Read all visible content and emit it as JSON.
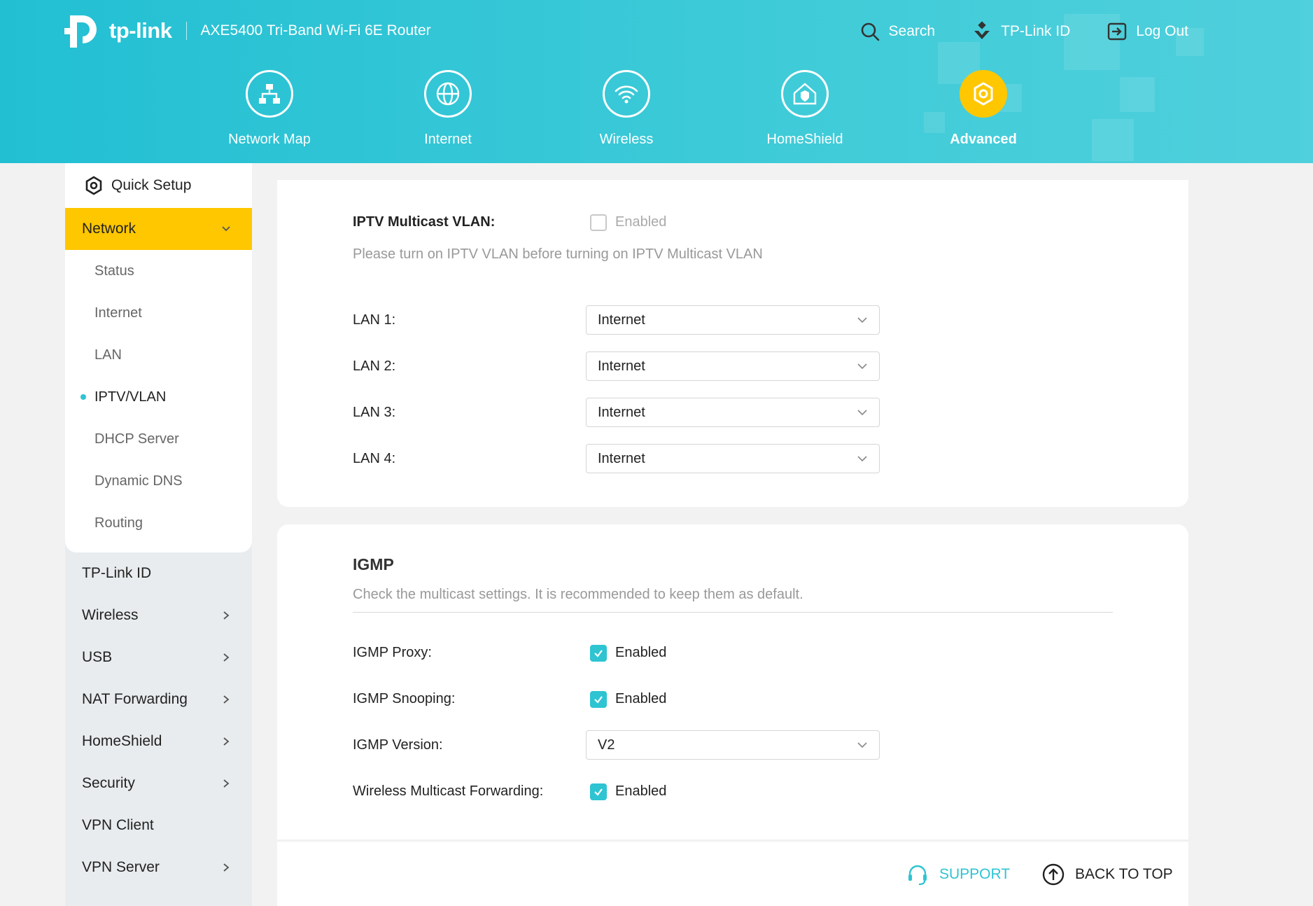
{
  "header": {
    "brand": "tp-link",
    "model": "AXE5400 Tri-Band Wi-Fi 6E Router",
    "actions": [
      {
        "label": "Search",
        "icon": "search-icon"
      },
      {
        "label": "TP-Link ID",
        "icon": "tplink-id-icon"
      },
      {
        "label": "Log Out",
        "icon": "logout-icon"
      }
    ],
    "nav": [
      {
        "label": "Network Map",
        "icon": "network-map-icon",
        "active": false
      },
      {
        "label": "Internet",
        "icon": "globe-icon",
        "active": false
      },
      {
        "label": "Wireless",
        "icon": "wifi-icon",
        "active": false
      },
      {
        "label": "HomeShield",
        "icon": "homeshield-icon",
        "active": false
      },
      {
        "label": "Advanced",
        "icon": "gear-icon",
        "active": true
      }
    ]
  },
  "sidebar": {
    "quick_setup": "Quick Setup",
    "network": {
      "label": "Network",
      "items": [
        {
          "label": "Status"
        },
        {
          "label": "Internet"
        },
        {
          "label": "LAN"
        },
        {
          "label": "IPTV/VLAN",
          "active": true
        },
        {
          "label": "DHCP Server"
        },
        {
          "label": "Dynamic DNS"
        },
        {
          "label": "Routing"
        }
      ]
    },
    "items": [
      {
        "label": "TP-Link ID",
        "expandable": false
      },
      {
        "label": "Wireless",
        "expandable": true
      },
      {
        "label": "USB",
        "expandable": true
      },
      {
        "label": "NAT Forwarding",
        "expandable": true
      },
      {
        "label": "HomeShield",
        "expandable": true
      },
      {
        "label": "Security",
        "expandable": true
      },
      {
        "label": "VPN Client",
        "expandable": false
      },
      {
        "label": "VPN Server",
        "expandable": true
      }
    ]
  },
  "iptv": {
    "multicast_vlan": {
      "label": "IPTV Multicast VLAN:",
      "checkbox_text": "Enabled",
      "checked": false
    },
    "note": "Please turn on IPTV VLAN before turning on IPTV Multicast VLAN",
    "lan_ports": [
      {
        "label": "LAN 1:",
        "value": "Internet"
      },
      {
        "label": "LAN 2:",
        "value": "Internet"
      },
      {
        "label": "LAN 3:",
        "value": "Internet"
      },
      {
        "label": "LAN 4:",
        "value": "Internet"
      }
    ]
  },
  "igmp": {
    "title": "IGMP",
    "description": "Check the multicast settings. It is recommended to keep them as default.",
    "proxy": {
      "label": "IGMP Proxy:",
      "text": "Enabled",
      "checked": true
    },
    "snooping": {
      "label": "IGMP Snooping:",
      "text": "Enabled",
      "checked": true
    },
    "version": {
      "label": "IGMP Version:",
      "value": "V2"
    },
    "wireless_forwarding": {
      "label": "Wireless Multicast Forwarding:",
      "text": "Enabled",
      "checked": true
    }
  },
  "footer": {
    "support": "SUPPORT",
    "back_to_top": "BACK TO TOP"
  },
  "colors": {
    "header": "#2ec4d2",
    "accent": "#ffc700",
    "checkbox": "#2ec4d2"
  }
}
